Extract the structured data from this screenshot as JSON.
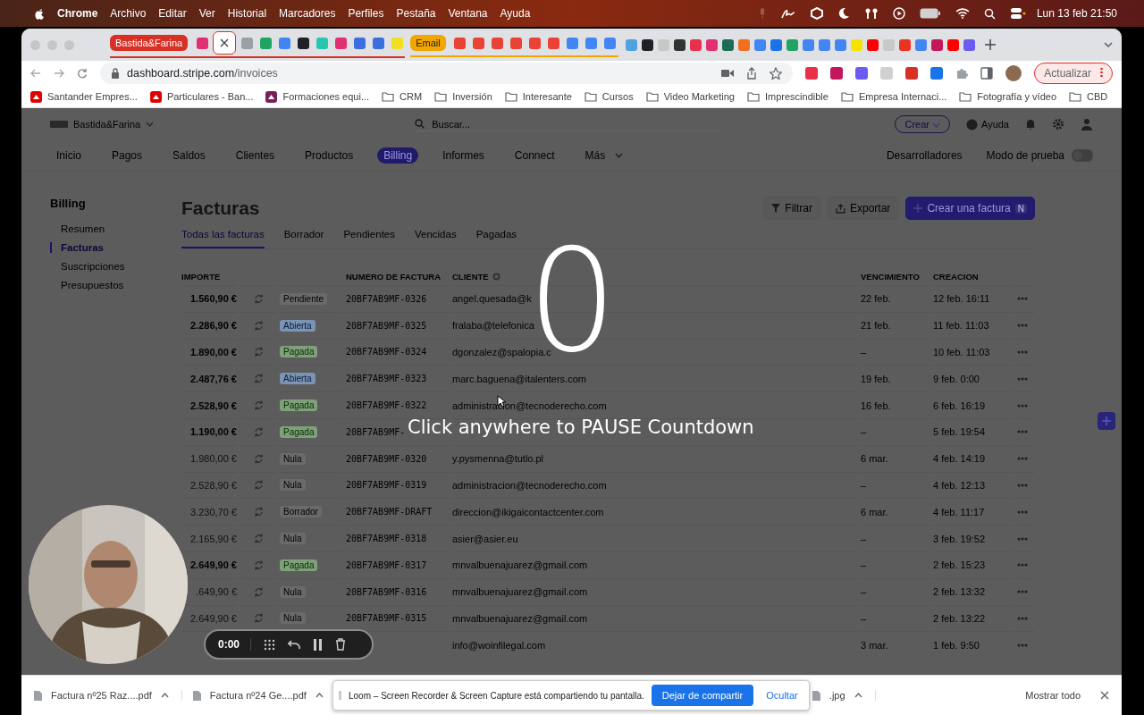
{
  "menubar": {
    "items": [
      {
        "label": "Chrome",
        "bold": true
      },
      {
        "label": "Archivo",
        "bold": false
      },
      {
        "label": "Editar",
        "bold": false
      },
      {
        "label": "Ver",
        "bold": false
      },
      {
        "label": "Historial",
        "bold": false
      },
      {
        "label": "Marcadores",
        "bold": false
      },
      {
        "label": "Perfiles",
        "bold": false
      },
      {
        "label": "Pestaña",
        "bold": false
      },
      {
        "label": "Ventana",
        "bold": false
      },
      {
        "label": "Ayuda",
        "bold": false
      }
    ],
    "clock": "Lun 13 feb 21:50"
  },
  "tab_strip": {
    "groups": [
      {
        "label": "Bastida&Farina",
        "color": "#d93025",
        "tabs": [
          {
            "color": "#e0306f",
            "selected": false
          },
          {
            "color": "#ffffff",
            "selected": true
          },
          {
            "color": "#9aa0a6",
            "selected": false
          },
          {
            "color": "#1fa463",
            "selected": false
          },
          {
            "color": "#4285f4",
            "selected": false
          },
          {
            "color": "#202124",
            "selected": false
          },
          {
            "color": "#26c6b0",
            "selected": false
          },
          {
            "color": "#e0306f",
            "selected": false
          },
          {
            "color": "#3b6fe0",
            "selected": false
          },
          {
            "color": "#3b6fe0",
            "selected": false
          },
          {
            "color": "#f0e020",
            "selected": false
          }
        ]
      },
      {
        "label": "Email",
        "color": "#f2a600",
        "tabs": [
          {
            "color": "#ea4335",
            "selected": false
          },
          {
            "color": "#ea4335",
            "selected": false
          },
          {
            "color": "#ea4335",
            "selected": false
          },
          {
            "color": "#ea4335",
            "selected": false
          },
          {
            "color": "#ea4335",
            "selected": false
          },
          {
            "color": "#ea4335",
            "selected": false
          },
          {
            "color": "#4285f4",
            "selected": false
          },
          {
            "color": "#4285f4",
            "selected": false
          },
          {
            "color": "#4285f4",
            "selected": false
          }
        ]
      }
    ],
    "tabs": [
      {
        "color": "#4fa3e0",
        "selected": false
      },
      {
        "color": "#202124",
        "selected": false
      },
      {
        "color": "#c8c8c8",
        "selected": false
      },
      {
        "color": "#333333",
        "selected": false
      },
      {
        "color": "#e8304a",
        "selected": false
      },
      {
        "color": "#e0306f",
        "selected": false
      },
      {
        "color": "#1d6b55",
        "selected": false
      },
      {
        "color": "#f07020",
        "selected": false
      },
      {
        "color": "#4285f4",
        "selected": false
      },
      {
        "color": "#1a73e8",
        "selected": false
      },
      {
        "color": "#1fa463",
        "selected": false
      },
      {
        "color": "#4285f4",
        "selected": false
      },
      {
        "color": "#4285f4",
        "selected": false
      },
      {
        "color": "#4285f4",
        "selected": false
      },
      {
        "color": "#f5e400",
        "selected": false
      },
      {
        "color": "#ff0000",
        "selected": false
      },
      {
        "color": "#c8c8c8",
        "selected": false
      },
      {
        "color": "#ea3323",
        "selected": false
      },
      {
        "color": "#4285f4",
        "selected": false
      },
      {
        "color": "#c2185b",
        "selected": false
      },
      {
        "color": "#ff0000",
        "selected": false
      },
      {
        "color": "#6a5cf0",
        "selected": false
      }
    ]
  },
  "address_bar": {
    "host": "dashboard.stripe.com",
    "path": "/invoices",
    "extensions": [
      {
        "color": "#e8304a"
      },
      {
        "color": "#c2185b"
      },
      {
        "color": "#6a5cf0"
      },
      {
        "color": "#d0d0d0"
      },
      {
        "color": "#d93025"
      },
      {
        "color": "#1a73e8"
      }
    ],
    "update_button": "Actualizar"
  },
  "bookmarks": [
    {
      "kind": "site",
      "label": "Santander Empres...",
      "color": "#e00000"
    },
    {
      "kind": "site",
      "label": "Particulares - Ban...",
      "color": "#e00000"
    },
    {
      "kind": "site",
      "label": "Formaciones equi...",
      "color": "#7b1f5a"
    },
    {
      "kind": "folder",
      "label": "CRM"
    },
    {
      "kind": "folder",
      "label": "Inversión"
    },
    {
      "kind": "folder",
      "label": "Interesante"
    },
    {
      "kind": "folder",
      "label": "Cursos"
    },
    {
      "kind": "folder",
      "label": "Video Marketing"
    },
    {
      "kind": "folder",
      "label": "Imprescindible"
    },
    {
      "kind": "folder",
      "label": "Empresa Internaci..."
    },
    {
      "kind": "folder",
      "label": "Fotografía y vídeo"
    },
    {
      "kind": "folder",
      "label": "CBD"
    }
  ],
  "stripe": {
    "account": "Bastida&Farina",
    "search_placeholder": "Buscar...",
    "create": "Crear",
    "help": "Ayuda",
    "nav": [
      {
        "label": "Inicio",
        "selected": false
      },
      {
        "label": "Pagos",
        "selected": false
      },
      {
        "label": "Saldos",
        "selected": false
      },
      {
        "label": "Clientes",
        "selected": false
      },
      {
        "label": "Productos",
        "selected": false
      },
      {
        "label": "Billing",
        "selected": true
      },
      {
        "label": "Informes",
        "selected": false
      },
      {
        "label": "Connect",
        "selected": false
      },
      {
        "label": "Más",
        "selected": false
      }
    ],
    "developers": "Desarrolladores",
    "test_mode": {
      "label": "Modo de prueba",
      "on": false
    },
    "sidebar": {
      "title": "Billing",
      "items": [
        {
          "label": "Resumen",
          "selected": false
        },
        {
          "label": "Facturas",
          "selected": true
        },
        {
          "label": "Suscripciones",
          "selected": false
        },
        {
          "label": "Presupuestos",
          "selected": false
        }
      ]
    },
    "title": "Facturas",
    "tabs": [
      {
        "label": "Todas las facturas",
        "selected": true
      },
      {
        "label": "Borrador",
        "selected": false
      },
      {
        "label": "Pendientes",
        "selected": false
      },
      {
        "label": "Vencidas",
        "selected": false
      },
      {
        "label": "Pagadas",
        "selected": false
      }
    ],
    "actions": {
      "filter": "Filtrar",
      "export": "Exportar",
      "create": "Crear una factura",
      "shortcut": "N"
    },
    "columns": {
      "amount": "IMPORTE",
      "number": "NUMERO DE FACTURA",
      "client": "CLIENTE",
      "due": "VENCIMIENTO",
      "created": "CREACION"
    },
    "rows": [
      {
        "amount": "1.560,90 €",
        "kind": "pendiente",
        "status": "Pendiente",
        "number": "20BF7AB9MF-0326",
        "client": "angel.quesada@k",
        "due": "22 feb.",
        "created": "12 feb. 16:11"
      },
      {
        "amount": "2.286,90 €",
        "kind": "abierta",
        "status": "Abierta",
        "number": "20BF7AB9MF-0325",
        "client": "fralaba@telefonica",
        "due": "21 feb.",
        "created": "11 feb. 11:03"
      },
      {
        "amount": "1.890,00 €",
        "kind": "pagada",
        "status": "Pagada",
        "number": "20BF7AB9MF-0324",
        "client": "dgonzalez@spalopia.c",
        "due": "–",
        "created": "10 feb. 11:03"
      },
      {
        "amount": "2.487,76 €",
        "kind": "abierta",
        "status": "Abierta",
        "number": "20BF7AB9MF-0323",
        "client": "marc.baguena@italenters.com",
        "due": "19 feb.",
        "created": "9 feb. 0:00"
      },
      {
        "amount": "2.528,90 €",
        "kind": "pagada",
        "status": "Pagada",
        "number": "20BF7AB9MF-0322",
        "client": "administracion@tecnoderecho.com",
        "due": "16 feb.",
        "created": "6 feb. 16:19"
      },
      {
        "amount": "1.190,00 €",
        "kind": "pagada",
        "status": "Pagada",
        "number": "20BF7AB9MF-",
        "due": "–",
        "created": "5 feb. 19:54"
      },
      {
        "amount": "1.980,00 €",
        "kind": "nula",
        "status": "Nula",
        "number": "20BF7AB9MF-0320",
        "client": "y.pysmenna@tutlo.pl",
        "due": "6 mar.",
        "created": "4 feb. 14:19"
      },
      {
        "amount": "2.528,90 €",
        "kind": "nula",
        "status": "Nula",
        "number": "20BF7AB9MF-0319",
        "client": "administracion@tecnoderecho.com",
        "due": "–",
        "created": "4 feb. 12:13"
      },
      {
        "amount": "3.230,70 €",
        "kind": "borrador",
        "status": "Borrador",
        "number": "20BF7AB9MF-DRAFT",
        "client": "direccion@ikigaicontactcenter.com",
        "due": "6 mar.",
        "created": "4 feb. 11:17"
      },
      {
        "amount": "2.165,90 €",
        "kind": "nula",
        "status": "Nula",
        "number": "20BF7AB9MF-0318",
        "client": "asier@asier.eu",
        "due": "–",
        "created": "3 feb. 19:52"
      },
      {
        "amount": "2.649,90 €",
        "kind": "pagada",
        "status": "Pagada",
        "number": "20BF7AB9MF-0317",
        "client": "mnvalbuenajuarez@gmail.com",
        "due": "–",
        "created": "2 feb. 15:23"
      },
      {
        "amount": ".649,90 €",
        "kind": "nula",
        "status": "Nula",
        "number": "20BF7AB9MF-0316",
        "client": "mnvalbuenajuarez@gmail.com",
        "due": "–",
        "created": "2 feb. 13:32"
      },
      {
        "amount": "2.649,90 €",
        "kind": "nula",
        "status": "Nula",
        "number": "20BF7AB9MF-0315",
        "client": "mnvalbuenajuarez@gmail.com",
        "due": "–",
        "created": "2 feb. 13:22"
      },
      {
        "client": "info@woinfilegal.com",
        "due": "3 mar.",
        "created": "1 feb. 9:50"
      }
    ]
  },
  "countdown": {
    "number": "0",
    "hint": "Click anywhere to PAUSE Countdown"
  },
  "recorder": {
    "time": "0:00"
  },
  "downloads": {
    "items": [
      "Factura nº25 Raz....pdf",
      "Factura nº24 Ge....pdf",
      ".jpg"
    ],
    "show_all": "Mostrar todo"
  },
  "sharing_notice": {
    "text": "Loom – Screen Recorder & Screen Capture está compartiendo tu pantalla.",
    "stop": "Dejar de compartir",
    "hide": "Ocultar"
  }
}
